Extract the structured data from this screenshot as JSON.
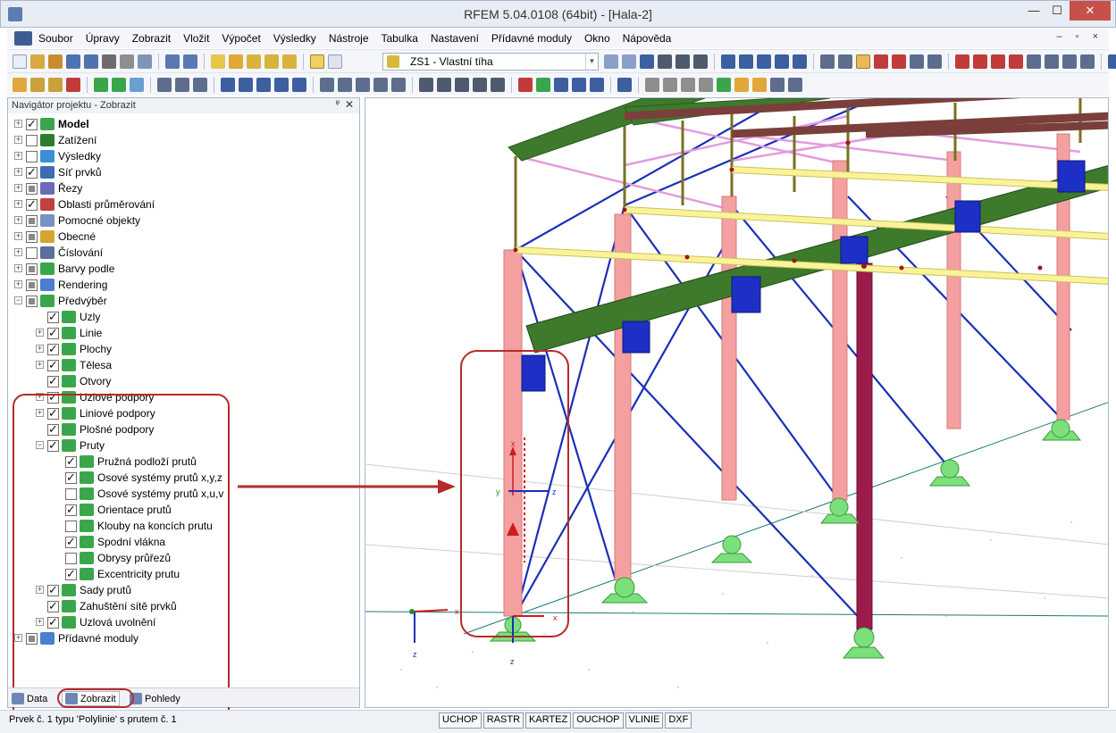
{
  "window": {
    "title": "RFEM 5.04.0108 (64bit) - [Hala-2]",
    "min": "—",
    "max": "☐",
    "close": "✕"
  },
  "menu": {
    "items": [
      "Soubor",
      "Úpravy",
      "Zobrazit",
      "Vložit",
      "Výpočet",
      "Výsledky",
      "Nástroje",
      "Tabulka",
      "Nastavení",
      "Přídavné moduly",
      "Okno",
      "Nápověda"
    ],
    "mdi": "– ▫ ×"
  },
  "toolbar": {
    "load_case": "ZS1 - Vlastní tíha"
  },
  "navigator": {
    "title": "Navigátor projektu - Zobrazit",
    "pin": "ᵠ",
    "close": "✕",
    "tree": [
      {
        "label": "Model",
        "bold": true,
        "level": 0,
        "check": "checked",
        "exp": "+",
        "icon": "#3aa64b"
      },
      {
        "label": "Zatížení",
        "level": 0,
        "check": "none",
        "exp": "+",
        "icon": "#2d7d2d"
      },
      {
        "label": "Výsledky",
        "level": 0,
        "check": "none",
        "exp": "+",
        "icon": "#3b8fd6"
      },
      {
        "label": "Síť prvků",
        "level": 0,
        "check": "checked",
        "exp": "+",
        "icon": "#3d6bb5"
      },
      {
        "label": "Řezy",
        "level": 0,
        "check": "partial",
        "exp": "+",
        "icon": "#6b6bb8"
      },
      {
        "label": "Oblasti průměrování",
        "level": 0,
        "check": "checked",
        "exp": "+",
        "icon": "#c24040"
      },
      {
        "label": "Pomocné objekty",
        "level": 0,
        "check": "partial",
        "exp": "+",
        "icon": "#7a91c4"
      },
      {
        "label": "Obecné",
        "level": 0,
        "check": "partial",
        "exp": "+",
        "icon": "#d6a32e"
      },
      {
        "label": "Číslování",
        "level": 0,
        "check": "none",
        "exp": "+",
        "icon": "#5a6f99"
      },
      {
        "label": "Barvy podle",
        "level": 0,
        "check": "partial",
        "exp": "+",
        "icon": "#3aa64b"
      },
      {
        "label": "Rendering",
        "level": 0,
        "check": "partial",
        "exp": "+",
        "icon": "#4a7fd0"
      },
      {
        "label": "Předvýběr",
        "level": 0,
        "check": "partial",
        "exp": "−",
        "icon": "#3aa64b"
      },
      {
        "label": "Uzly",
        "level": 1,
        "check": "checked",
        "exp": "",
        "icon": "#3aa64b"
      },
      {
        "label": "Linie",
        "level": 1,
        "check": "checked",
        "exp": "+",
        "icon": "#3aa64b"
      },
      {
        "label": "Plochy",
        "level": 1,
        "check": "checked",
        "exp": "+",
        "icon": "#3aa64b"
      },
      {
        "label": "Tělesa",
        "level": 1,
        "check": "checked",
        "exp": "+",
        "icon": "#3aa64b"
      },
      {
        "label": "Otvory",
        "level": 1,
        "check": "checked",
        "exp": "",
        "icon": "#3aa64b"
      },
      {
        "label": "Uzlové podpory",
        "level": 1,
        "check": "checked",
        "exp": "+",
        "icon": "#3aa64b"
      },
      {
        "label": "Liniové podpory",
        "level": 1,
        "check": "checked",
        "exp": "+",
        "icon": "#3aa64b"
      },
      {
        "label": "Plošné podpory",
        "level": 1,
        "check": "checked",
        "exp": "",
        "icon": "#3aa64b"
      },
      {
        "label": "Pruty",
        "level": 1,
        "check": "checked",
        "exp": "−",
        "icon": "#3aa64b"
      },
      {
        "label": "Pružná podloží prutů",
        "level": 2,
        "check": "checked",
        "exp": "",
        "icon": "#3aa64b"
      },
      {
        "label": "Osové systémy prutů x,y,z",
        "level": 2,
        "check": "checked",
        "exp": "",
        "icon": "#3aa64b"
      },
      {
        "label": "Osové systémy prutů x,u,v",
        "level": 2,
        "check": "none",
        "exp": "",
        "icon": "#3aa64b"
      },
      {
        "label": "Orientace prutů",
        "level": 2,
        "check": "checked",
        "exp": "",
        "icon": "#3aa64b"
      },
      {
        "label": "Klouby na koncích prutu",
        "level": 2,
        "check": "none",
        "exp": "",
        "icon": "#3aa64b"
      },
      {
        "label": "Spodní vlákna",
        "level": 2,
        "check": "checked",
        "exp": "",
        "icon": "#3aa64b"
      },
      {
        "label": "Obrysy průřezů",
        "level": 2,
        "check": "none",
        "exp": "",
        "icon": "#3aa64b"
      },
      {
        "label": "Excentricity prutu",
        "level": 2,
        "check": "checked",
        "exp": "",
        "icon": "#3aa64b"
      },
      {
        "label": "Sady prutů",
        "level": 1,
        "check": "checked",
        "exp": "+",
        "icon": "#3aa64b"
      },
      {
        "label": "Zahuštění sítě prvků",
        "level": 1,
        "check": "checked",
        "exp": "",
        "icon": "#3aa64b"
      },
      {
        "label": "Uzlová uvolnění",
        "level": 1,
        "check": "checked",
        "exp": "+",
        "icon": "#3aa64b"
      },
      {
        "label": "Přídavné moduly",
        "level": 0,
        "check": "partial",
        "exp": "+",
        "icon": "#4a7fd0"
      }
    ],
    "tabs": [
      "Data",
      "Zobrazit",
      "Pohledy"
    ]
  },
  "viewport": {
    "axis_labels": {
      "x": "x",
      "y": "y",
      "z": "z"
    }
  },
  "status": {
    "text": "Prvek č. 1 typu 'Polylinie' s prutem č. 1",
    "buttons": [
      "UCHOP",
      "RASTR",
      "KARTEZ",
      "OUCHOP",
      "VLINIE",
      "DXF"
    ]
  },
  "colors": {
    "highlight": "#b52b2b",
    "column_pink": "#f4a0a0",
    "beam_green": "#3e7a2c",
    "purlin_yellow": "#fbf29a",
    "bracing_blue": "#1a2fb8",
    "support_green": "#7be07b"
  }
}
